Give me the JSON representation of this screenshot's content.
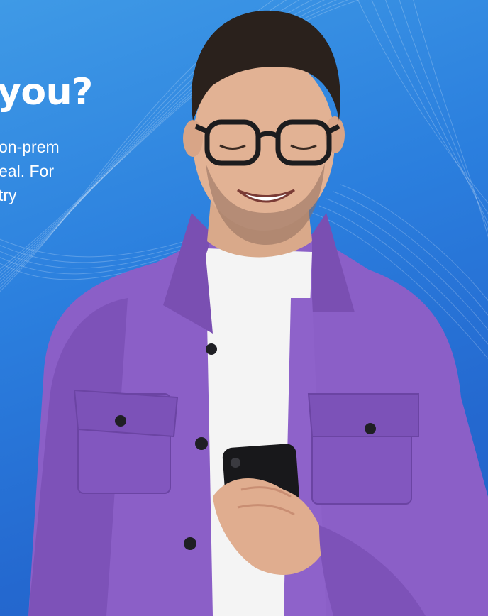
{
  "hero": {
    "headline": "you?",
    "body_lines": [
      "on-prem",
      "eal. For",
      "try"
    ]
  },
  "colors": {
    "background_top": "#3f9ae6",
    "background_bottom": "#2360c8",
    "shirt": "#8b5fc7",
    "tshirt": "#ffffff"
  }
}
